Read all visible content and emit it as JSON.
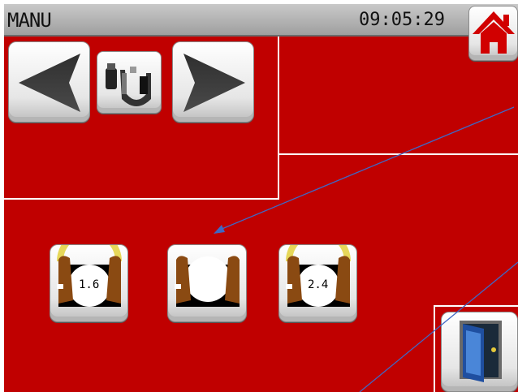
{
  "header": {
    "mode_title": "MANU",
    "clock": "09:05:29"
  },
  "toolbar": {
    "home_icon": "home-icon",
    "prev_icon": "arrow-left-icon",
    "tool_icon": "gripper-tool-icon",
    "next_icon": "arrow-right-icon"
  },
  "gripper_positions": [
    {
      "label": "1.6",
      "icon": "gripper-open-gauge-icon"
    },
    {
      "label": "",
      "icon": "gripper-center-icon"
    },
    {
      "label": "2.4",
      "icon": "gripper-open-gauge-icon"
    }
  ],
  "exit": {
    "icon": "exit-door-icon"
  },
  "colors": {
    "screen_bg": "#c00000",
    "titlebar": "#b4b4b4",
    "home_roof": "#d10000",
    "annotation_line": "#3f67c4"
  }
}
